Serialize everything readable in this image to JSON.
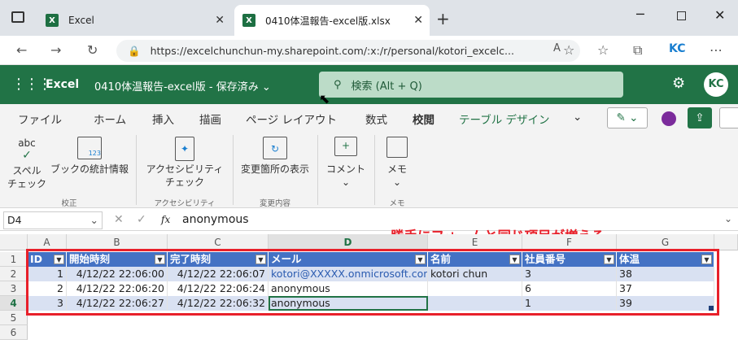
{
  "browser": {
    "tabs": [
      {
        "label": "Excel"
      },
      {
        "label": "0410体温報告-excel版.xlsx"
      }
    ],
    "url": "https://excelchunchun-my.sharepoint.com/:x:/r/personal/kotori_excelc...",
    "profile": "KC"
  },
  "app": {
    "name": "Excel",
    "doc_title": "0410体温報告-excel版 - 保存済み",
    "search_placeholder": "検索 (Alt + Q)",
    "avatar": "KC"
  },
  "menu": [
    "ファイル",
    "ホーム",
    "挿入",
    "描画",
    "ページ レイアウト",
    "数式",
    "校閲",
    "テーブル デザイン"
  ],
  "ribbon": {
    "spell_top": "abc",
    "spell_label": "スペル\nチェック",
    "stats_label": "ブックの統計情報",
    "a11y_label": "アクセシビリティ\nチェック",
    "changes_label": "変更箇所の表示",
    "comment_label": "コメント",
    "memo_label": "メモ",
    "groups": [
      "校正",
      "アクセシビリティ",
      "変更内容",
      "メモ"
    ]
  },
  "formula_bar": {
    "name_box": "D4",
    "fx": "fx",
    "value": "anonymous"
  },
  "annotation": "勝手にフォームと同じ項目が増える",
  "sheet": {
    "columns": [
      "A",
      "B",
      "C",
      "D",
      "E",
      "F",
      "G"
    ],
    "rows": [
      "1",
      "2",
      "3",
      "4",
      "5",
      "6"
    ],
    "headers": [
      "ID",
      "開始時刻",
      "完了時刻",
      "メール",
      "名前",
      "社員番号",
      "体温"
    ],
    "data": [
      [
        "1",
        "4/12/22 22:06:00",
        "4/12/22 22:06:07",
        "kotori@XXXXX.onmicrosoft.com",
        "kotori chun",
        "3",
        "38"
      ],
      [
        "2",
        "4/12/22 22:06:20",
        "4/12/22 22:06:24",
        "anonymous",
        "",
        "6",
        "37"
      ],
      [
        "3",
        "4/12/22 22:06:27",
        "4/12/22 22:06:32",
        "anonymous",
        "",
        "1",
        "39"
      ]
    ]
  },
  "colors": {
    "excel_green": "#217346",
    "table_header": "#4472c4",
    "band": "#d9e1f2",
    "highlight": "#e8202a"
  }
}
